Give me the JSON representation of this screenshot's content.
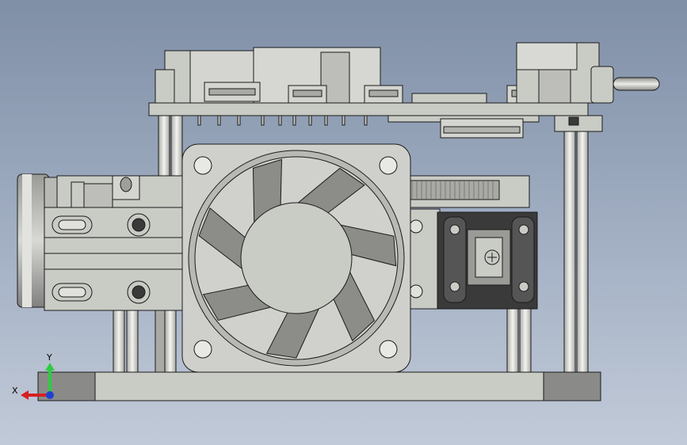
{
  "view": {
    "background_top": "#7f8fa6",
    "background_bottom": "#c1cad8",
    "part_color": "#c9cbc5",
    "edge_color": "#1b1b1b",
    "dark_part_color": "#3a3a3a"
  },
  "triad": {
    "y_label": "Y",
    "x_label": "X",
    "y_color": "#2ecc40",
    "x_color": "#d62020",
    "z_color": "#2040d0"
  },
  "model": {
    "fan_blade_count": 7,
    "fan_blade_color": "#8c8c88"
  }
}
